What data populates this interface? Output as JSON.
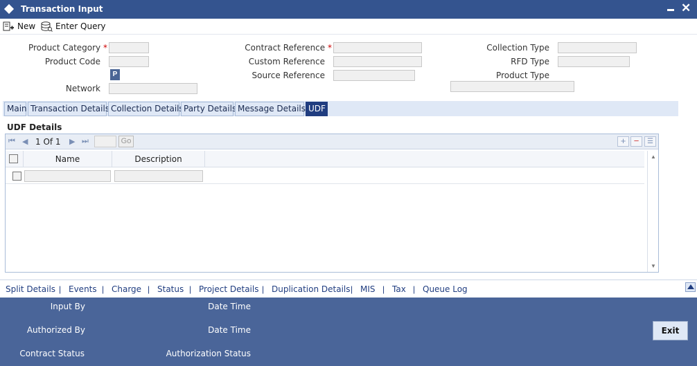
{
  "window": {
    "title": "Transaction Input"
  },
  "toolbar": {
    "new_label": "New",
    "enter_query_label": "Enter Query"
  },
  "form": {
    "product_category": "Product Category",
    "product_code": "Product Code",
    "p_button": "P",
    "network": "Network",
    "contract_reference": "Contract Reference",
    "custom_reference": "Custom Reference",
    "source_reference": "Source Reference",
    "collection_type": "Collection Type",
    "rfd_type": "RFD Type",
    "product_type": "Product Type",
    "required_marker": "*"
  },
  "tabs": [
    {
      "label": "Main"
    },
    {
      "label": "Transaction Details"
    },
    {
      "label": "Collection Details"
    },
    {
      "label": "Party Details"
    },
    {
      "label": "Message Details"
    },
    {
      "label": "UDF"
    }
  ],
  "udf": {
    "section_title": "UDF Details",
    "pager": {
      "text": "1 Of 1",
      "go_label": "Go"
    },
    "columns": [
      "Name",
      "Description"
    ]
  },
  "links": [
    "Split Details",
    "Events",
    "Charge",
    "Status",
    "Project Details",
    "Duplication Details",
    "MIS",
    "Tax",
    "Queue Log"
  ],
  "link_separator": "|",
  "footer": {
    "input_by": "Input By",
    "date_time_1": "Date Time",
    "authorized_by": "Authorized By",
    "date_time_2": "Date Time",
    "contract_status": "Contract Status",
    "authorization_status": "Authorization Status",
    "exit_label": "Exit"
  },
  "colors": {
    "titlebar": "#34548f",
    "active_tab": "#203d80",
    "footer": "#4a6599",
    "required": "#cc0000"
  }
}
